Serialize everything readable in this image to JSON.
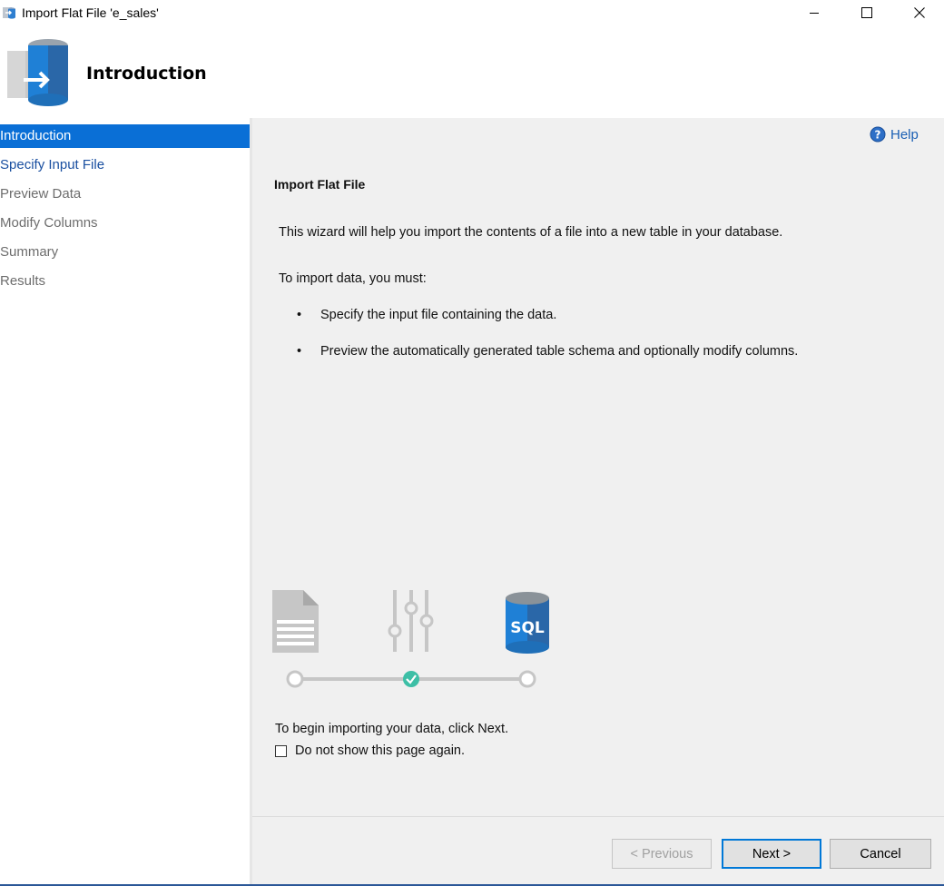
{
  "window": {
    "title": "Import Flat File 'e_sales'",
    "minimize_icon": "minimize-icon",
    "maximize_icon": "maximize-icon",
    "close_icon": "close-icon"
  },
  "header": {
    "title": "Introduction",
    "icon": "database-import-icon"
  },
  "sidebar": {
    "items": [
      {
        "label": "Introduction",
        "state": "active"
      },
      {
        "label": "Specify Input File",
        "state": "link"
      },
      {
        "label": "Preview Data",
        "state": "disabled"
      },
      {
        "label": "Modify Columns",
        "state": "disabled"
      },
      {
        "label": "Summary",
        "state": "disabled"
      },
      {
        "label": "Results",
        "state": "disabled"
      }
    ]
  },
  "main": {
    "help_label": "Help",
    "section_title": "Import Flat File",
    "intro": "This wizard will help you import the contents of a file into a new table in your database.",
    "must": "To import data, you must:",
    "bullets": [
      "Specify the input file containing the data.",
      "Preview the automatically generated table schema and optionally modify columns."
    ],
    "illustration": {
      "database_label": "SQL",
      "icons": [
        "document-icon",
        "sliders-icon",
        "sql-database-icon"
      ]
    },
    "begin_text": "To begin importing your data, click Next.",
    "checkbox_label": "Do not show this page again.",
    "checkbox_checked": false
  },
  "footer": {
    "previous_label": "< Previous",
    "next_label": "Next >",
    "cancel_label": "Cancel"
  },
  "colors": {
    "accent": "#0a6fd6",
    "link": "#1a4fa0",
    "step_done": "#3dbfa6"
  }
}
